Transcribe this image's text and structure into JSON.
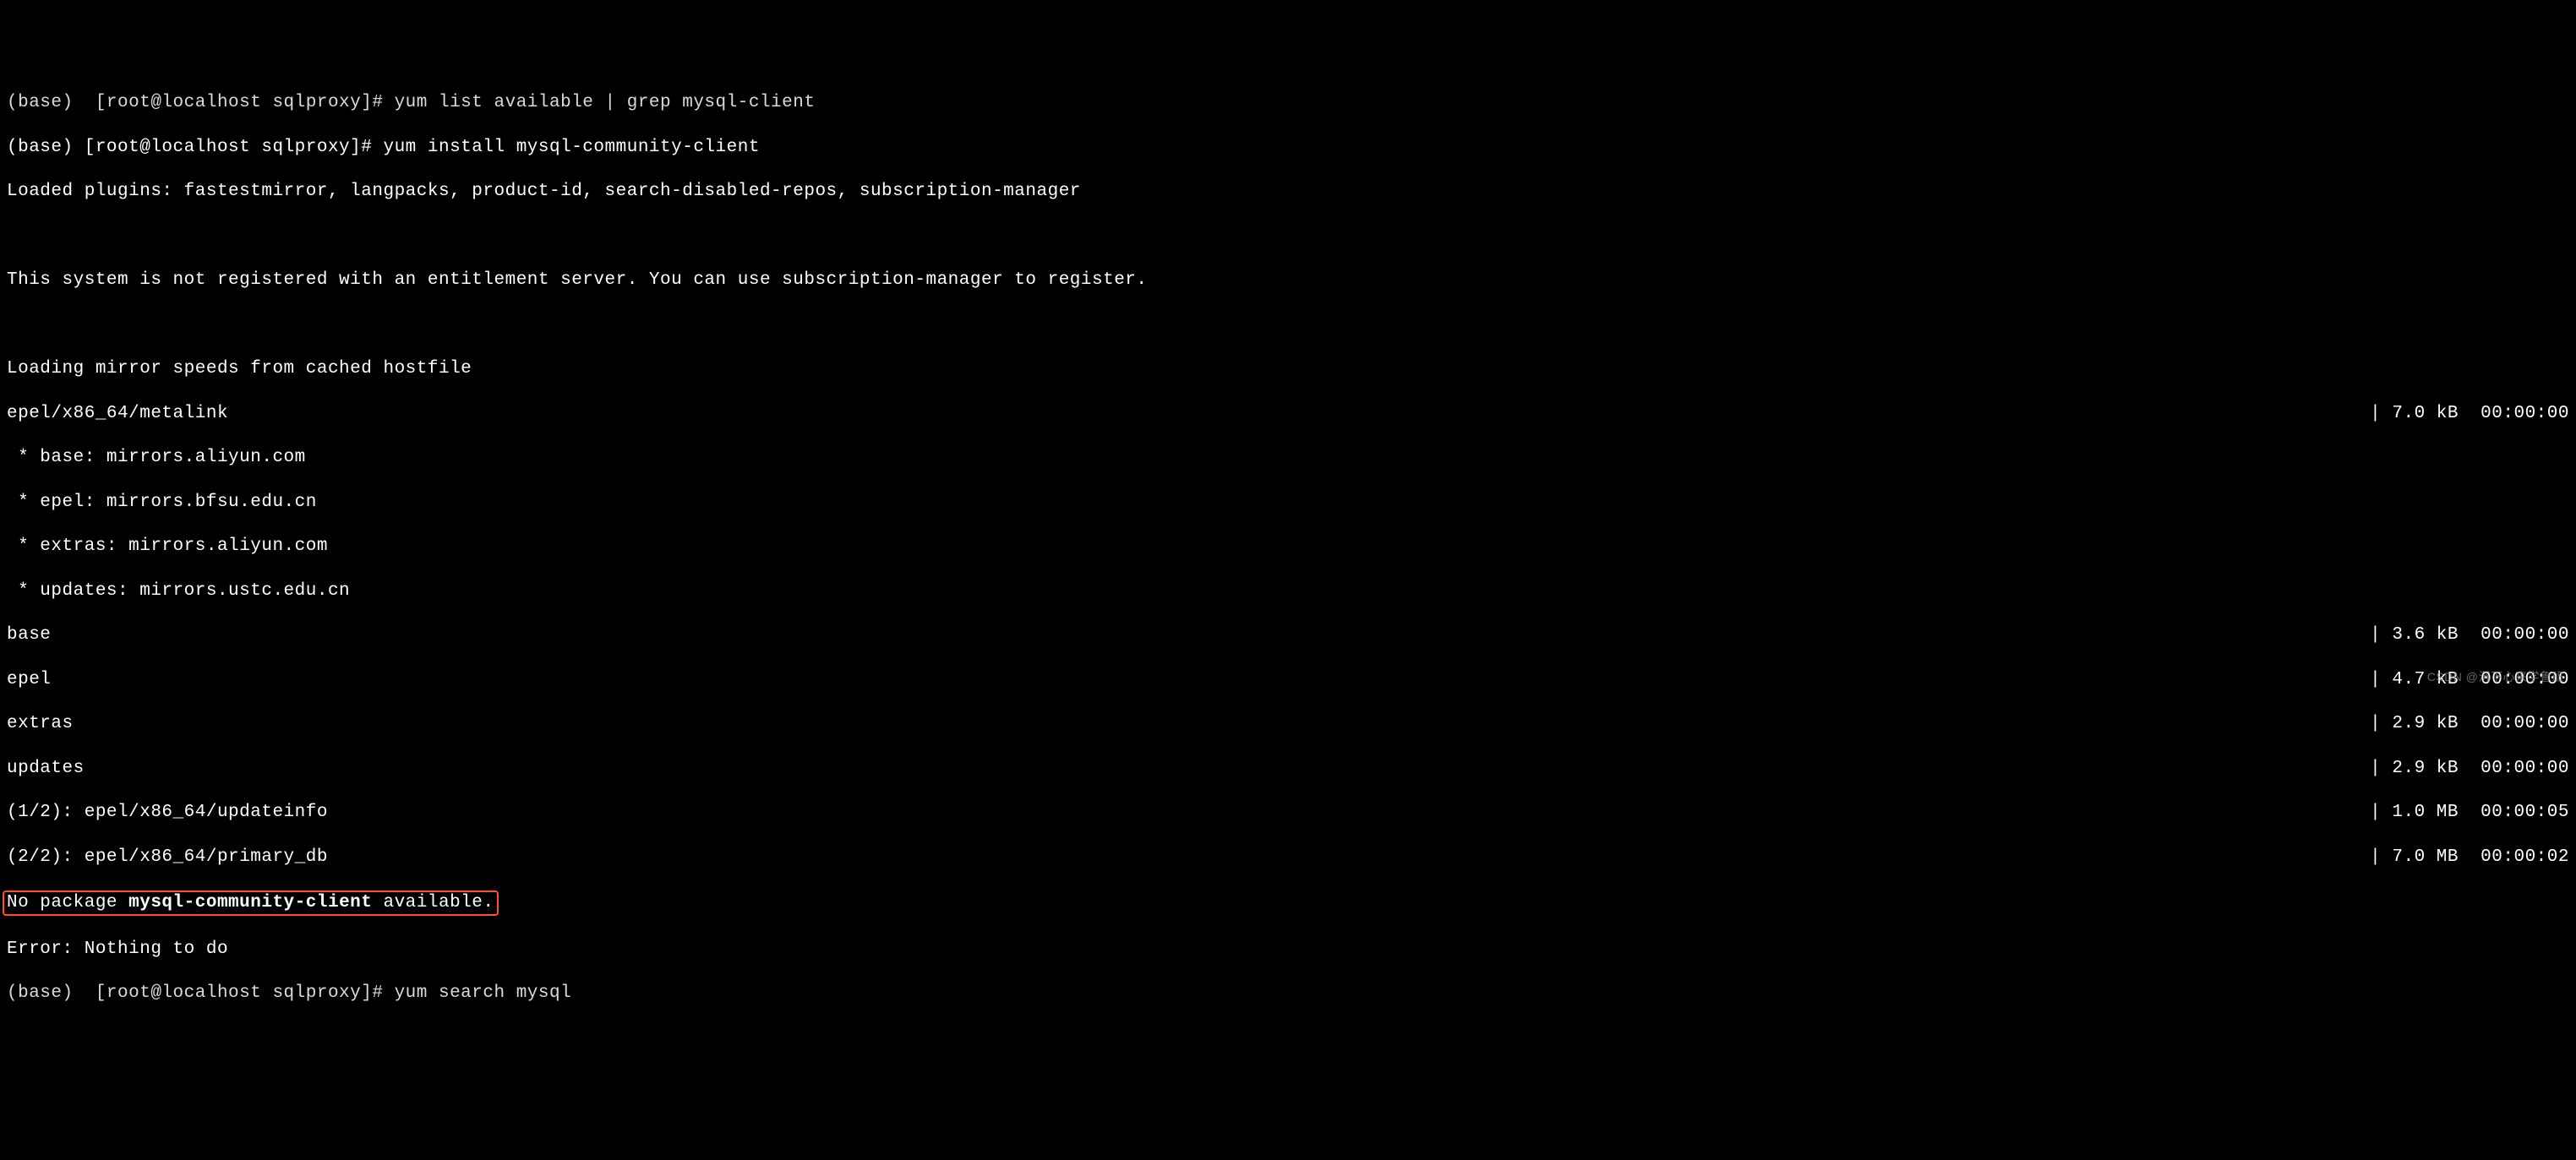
{
  "lines": {
    "top_cut": "(base)  [root@localhost sqlproxy]# yum list available | grep mysql-client",
    "prompt_line": "(base) [root@localhost sqlproxy]# yum install mysql-community-client",
    "plugins": "Loaded plugins: fastestmirror, langpacks, product-id, search-disabled-repos, subscription-manager",
    "blank": "",
    "not_registered": "This system is not registered with an entitlement server. You can use subscription-manager to register.",
    "loading_mirror": "Loading mirror speeds from cached hostfile",
    "metalink": {
      "left": "epel/x86_64/metalink",
      "right": "| 7.0 kB  00:00:00"
    },
    "mirror_base": " * base: mirrors.aliyun.com",
    "mirror_epel": " * epel: mirrors.bfsu.edu.cn",
    "mirror_extras": " * extras: mirrors.aliyun.com",
    "mirror_updates": " * updates: mirrors.ustc.edu.cn",
    "repo_base": {
      "left": "base",
      "right": "| 3.6 kB  00:00:00"
    },
    "repo_epel": {
      "left": "epel",
      "right": "| 4.7 kB  00:00:00"
    },
    "repo_extras": {
      "left": "extras",
      "right": "| 2.9 kB  00:00:00"
    },
    "repo_updates": {
      "left": "updates",
      "right": "| 2.9 kB  00:00:00"
    },
    "dl_1": {
      "left": "(1/2): epel/x86_64/updateinfo",
      "right": "| 1.0 MB  00:00:05"
    },
    "dl_2": {
      "left": "(2/2): epel/x86_64/primary_db",
      "right": "| 7.0 MB  00:00:02"
    },
    "no_pkg_pre": "No package ",
    "no_pkg_bold": "mysql-community-client",
    "no_pkg_post": " available.",
    "error": "Error: Nothing to do",
    "bottom_cut": "(base)  [root@localhost sqlproxy]# yum search mysql"
  },
  "watermark": "CSDN @沉下心来学鲁班"
}
